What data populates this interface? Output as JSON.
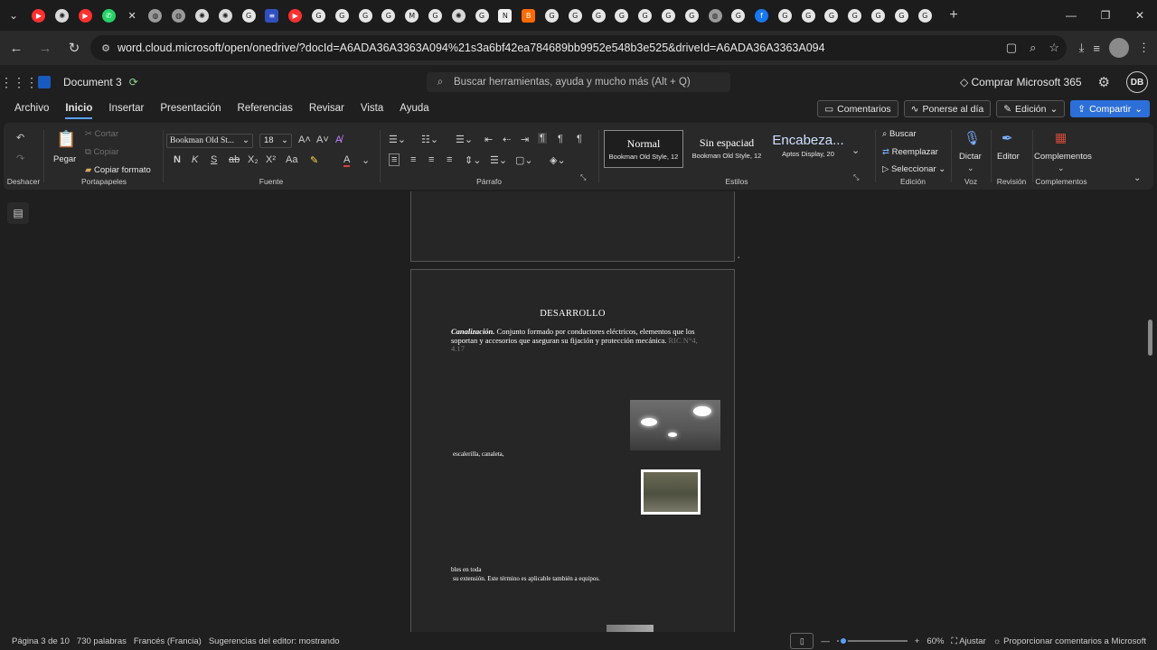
{
  "browser": {
    "url": "word.cloud.microsoft/open/onedrive/?docId=A6ADA36A3363A094%21s3a6bf42ea784689bb9952e548b3e525&driveId=A6ADA36A3363A094",
    "tab_count_icons": [
      "youtube-icon",
      "chatgpt-icon",
      "youtube-icon",
      "whatsapp-icon",
      "close-icon",
      "globe-icon",
      "globe-icon",
      "chatgpt-icon",
      "chatgpt-icon",
      "google-icon",
      "flag-icon",
      "youtube-icon",
      "google-icon",
      "google-icon",
      "google-icon",
      "google-icon",
      "gmail-icon",
      "google-icon",
      "chatgpt-icon",
      "google-icon",
      "notion-icon",
      "blogger-icon",
      "google-icon",
      "google-icon",
      "google-icon",
      "google-icon",
      "google-icon",
      "google-icon",
      "google-icon",
      "globe-icon",
      "google-icon",
      "facebook-icon",
      "google-icon",
      "google-icon",
      "google-icon",
      "google-icon",
      "google-icon",
      "google-icon",
      "google-icon"
    ],
    "new_tab": "+"
  },
  "word": {
    "doc_title": "Document 3",
    "search_placeholder": "Buscar herramientas, ayuda y mucho más (Alt + Q)",
    "buy": "Comprar Microsoft 365",
    "user_initials": "DB"
  },
  "ribbon_tabs": [
    "Archivo",
    "Inicio",
    "Insertar",
    "Presentación",
    "Referencias",
    "Revisar",
    "Vista",
    "Ayuda"
  ],
  "ribbon_right": {
    "comments": "Comentarios",
    "catchup": "Ponerse al día",
    "editing": "Edición",
    "share": "Compartir"
  },
  "ribbon": {
    "undo_group": "Deshacer",
    "paste": "Pegar",
    "cut": "Cortar",
    "copy": "Copiar",
    "format_painter": "Copiar formato",
    "clipboard_group": "Portapapeles",
    "font_name": "Bookman Old St...",
    "font_size": "18",
    "bold": "N",
    "italic": "K",
    "underline": "S",
    "font_group": "Fuente",
    "paragraph_group": "Párrafo",
    "styles": [
      {
        "name": "Normal",
        "sub": "Bookman Old Style, 12"
      },
      {
        "name": "Sin espaciad",
        "sub": "Bookman Old Style, 12"
      },
      {
        "name": "Encabeza...",
        "sub": "Aptos Display, 20"
      }
    ],
    "styles_group": "Estilos",
    "find": "Buscar",
    "replace": "Reemplazar",
    "select": "Seleccionar",
    "editing_group": "Edición",
    "dictate": "Dictar",
    "voice_group": "Voz",
    "editor": "Editor",
    "review_group": "Revisión",
    "addins": "Complementos",
    "addins_group": "Complementos"
  },
  "document": {
    "heading": "DESARROLLO",
    "para_term": "Canalización.",
    "para_text": " Conjunto formado por conductores eléctricos, elementos que los soportan y accesorios que aseguran su fijación y protección mecánica.",
    "para_ref": "RIC N°4, 4.17",
    "line1": "escalerilla, canaleta,",
    "line2": "bles en toda",
    "line3": "su extensión. Este término es aplicable también a equipos."
  },
  "status": {
    "page": "Página 3 de 10",
    "words": "730 palabras",
    "language": "Francés (Francia)",
    "editor": "Sugerencias del editor: mostrando",
    "zoom": "60%",
    "fit": "Ajustar",
    "feedback": "Proporcionar comentarios a Microsoft"
  }
}
